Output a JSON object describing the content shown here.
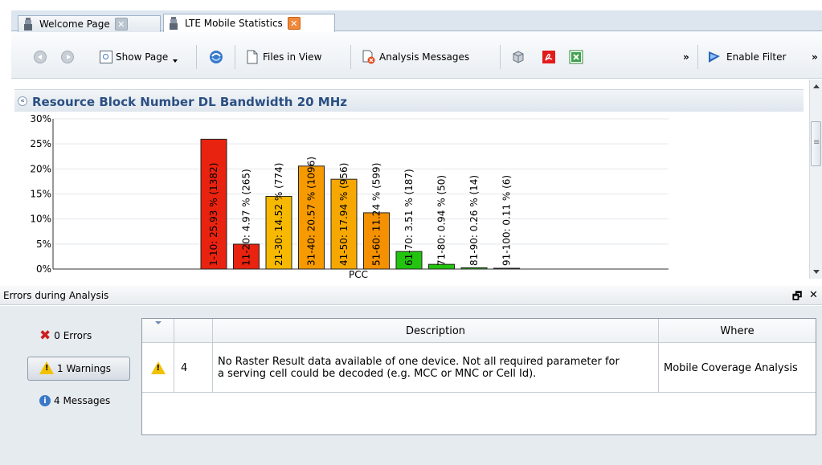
{
  "tabs": [
    {
      "label": "Welcome Page",
      "active": false
    },
    {
      "label": "LTE Mobile Statistics",
      "active": true
    }
  ],
  "toolbar": {
    "show_page": "Show Page",
    "files_in_view": "Files in View",
    "analysis_messages": "Analysis Messages",
    "overflow": "»",
    "enable_filter": "Enable Filter",
    "overflow2": "»"
  },
  "chart_panel": {
    "collapse_glyph": "«",
    "title": "Resource Block Number DL Bandwidth 20 MHz"
  },
  "chart_data": {
    "type": "bar",
    "title": "Resource Block Number DL Bandwidth 20 MHz",
    "xlabel": "PCC",
    "ylim": [
      0,
      30
    ],
    "y_ticks": [
      "0%",
      "5%",
      "10%",
      "15%",
      "20%",
      "25%",
      "30%"
    ],
    "y_tick_values": [
      0,
      5,
      10,
      15,
      20,
      25,
      30
    ],
    "categories": [
      "1-10",
      "11-20",
      "21-30",
      "31-40",
      "41-50",
      "51-60",
      "61-70",
      "71-80",
      "81-90",
      "91-100"
    ],
    "values": [
      25.93,
      4.97,
      14.52,
      20.57,
      17.94,
      11.24,
      3.51,
      0.94,
      0.26,
      0.11
    ],
    "labels": [
      "1-10: 25.93 % (1382)",
      "11-20: 4.97 % (265)",
      "21-30: 14.52 % (774)",
      "31-40: 20.57 % (1096)",
      "41-50: 17.94 % (956)",
      "51-60: 11.24 % (599)",
      "61-70: 3.51 % (187)",
      "71-80: 0.94 % (50)",
      "81-90: 0.26 % (14)",
      "91-100: 0.11 % (6)"
    ],
    "colors": [
      "#e8230f",
      "#e8230f",
      "#f7b800",
      "#f79a00",
      "#f7a800",
      "#f59000",
      "#22c40e",
      "#22c40e",
      "#22c40e",
      "#22c40e"
    ],
    "grid": true,
    "legend": "none"
  },
  "errors_panel": {
    "title": "Errors during Analysis",
    "restore_glyph": "🗗",
    "close_glyph": "✕",
    "filters": [
      {
        "label": "0 Errors",
        "selected": false
      },
      {
        "label": "1 Warnings",
        "selected": true
      },
      {
        "label": "4 Messages",
        "selected": false
      }
    ],
    "columns": [
      "",
      "",
      "Description",
      "Where"
    ],
    "rows": [
      {
        "icon": "warning-icon",
        "num": "4",
        "description_line1": "No Raster Result data available of one device. Not all required parameter for",
        "description_line2": "a serving cell could be decoded (e.g. MCC or MNC or Cell Id).",
        "where": "Mobile Coverage Analysis"
      }
    ]
  },
  "colors": {
    "title_blue": "#2a4f82",
    "warning_yellow": "#f2c200",
    "error_red": "#cc1f1f",
    "info_blue": "#3a78c8"
  }
}
